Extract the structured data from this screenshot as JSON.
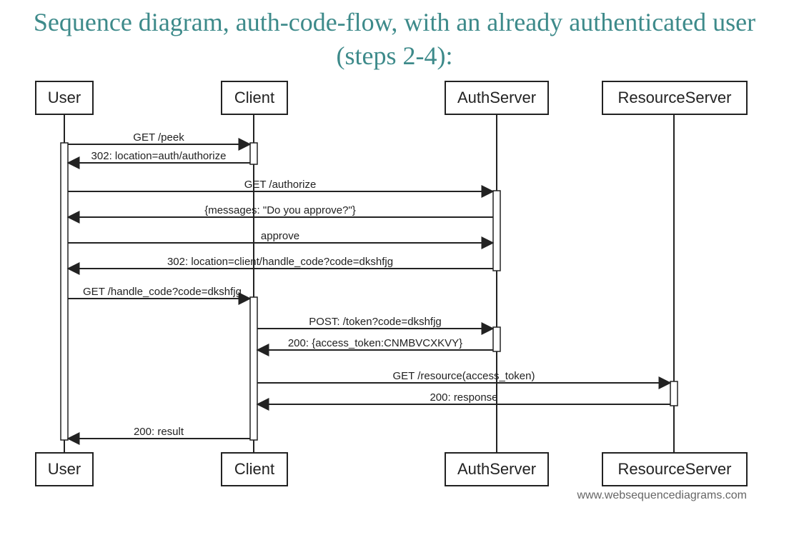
{
  "title": "Sequence diagram, auth-code-flow, with an already authenticated user (steps 2-4):",
  "actors": {
    "user": "User",
    "client": "Client",
    "authserver": "AuthServer",
    "resourceserver": "ResourceServer"
  },
  "messages": {
    "m1": "GET /peek",
    "m2": "302: location=auth/authorize",
    "m3": "GET /authorize",
    "m4": "{messages: \"Do you approve?\"}",
    "m5": "approve",
    "m6": "302: location=client/handle_code?code=dkshfjg",
    "m7": "GET /handle_code?code=dkshfjg",
    "m8": "POST: /token?code=dkshfjg",
    "m9": "200: {access_token:CNMBVCXKVY}",
    "m10": "GET /resource(access_token)",
    "m11": "200: response",
    "m12": "200: result"
  },
  "attribution": "www.websequencediagrams.com"
}
